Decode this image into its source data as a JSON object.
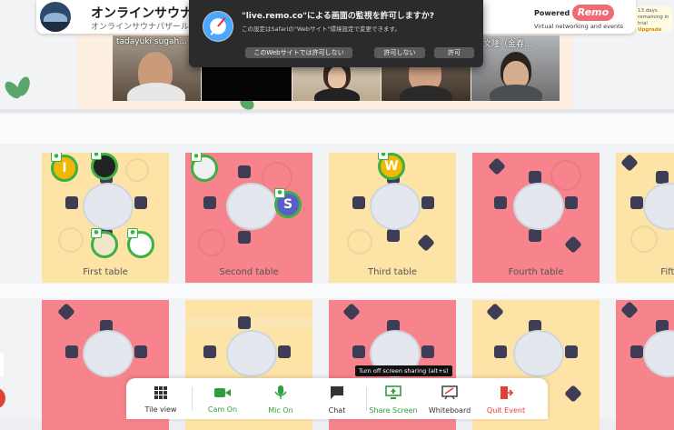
{
  "header": {
    "title": "オンラインサウナパ",
    "subtitle": "オンラインサウナパザールの出",
    "powered_by": "Powered by",
    "brand": "Remo",
    "tagline": "Virtual networking and events",
    "trial_text": "13 days remaining in trial",
    "upgrade_label": "Upgrade",
    "brand_color": "#ef6a72"
  },
  "videos": [
    {
      "name": "tadayuki sugah..."
    },
    {
      "name": ""
    },
    {
      "name": ""
    },
    {
      "name": ""
    },
    {
      "name": "屋文隆（金春..."
    }
  ],
  "dialog": {
    "title": "\"live.remo.co\"による画面の監視を許可しますか?",
    "text": "この設定はSafariの\"Webサイト\"環境設定で変更できます。",
    "never_label": "このWebサイトでは許可しない",
    "deny_label": "許可しない",
    "allow_label": "許可"
  },
  "tables": [
    {
      "label": "First table",
      "color": "#fde3a6"
    },
    {
      "label": "Second table",
      "color": "#f7838c"
    },
    {
      "label": "Third table",
      "color": "#fde3a6"
    },
    {
      "label": "Fourth table",
      "color": "#f7838c"
    },
    {
      "label": "Fifth",
      "color": "#fde3a6"
    }
  ],
  "avatars": {
    "first_table_initial": "I",
    "second_table_initial": "S",
    "third_table_initial": "W"
  },
  "tooltip": "Turn off screen sharing (alt+s)",
  "toolbar": {
    "tile_view": "Tile view",
    "cam_on": "Cam On",
    "mic_on": "Mic On",
    "chat": "Chat",
    "share_screen": "Share Screen",
    "whiteboard": "Whiteboard",
    "quit_event": "Quit Event",
    "active_color": "#2e9e3e",
    "quit_color": "#e0413a"
  }
}
